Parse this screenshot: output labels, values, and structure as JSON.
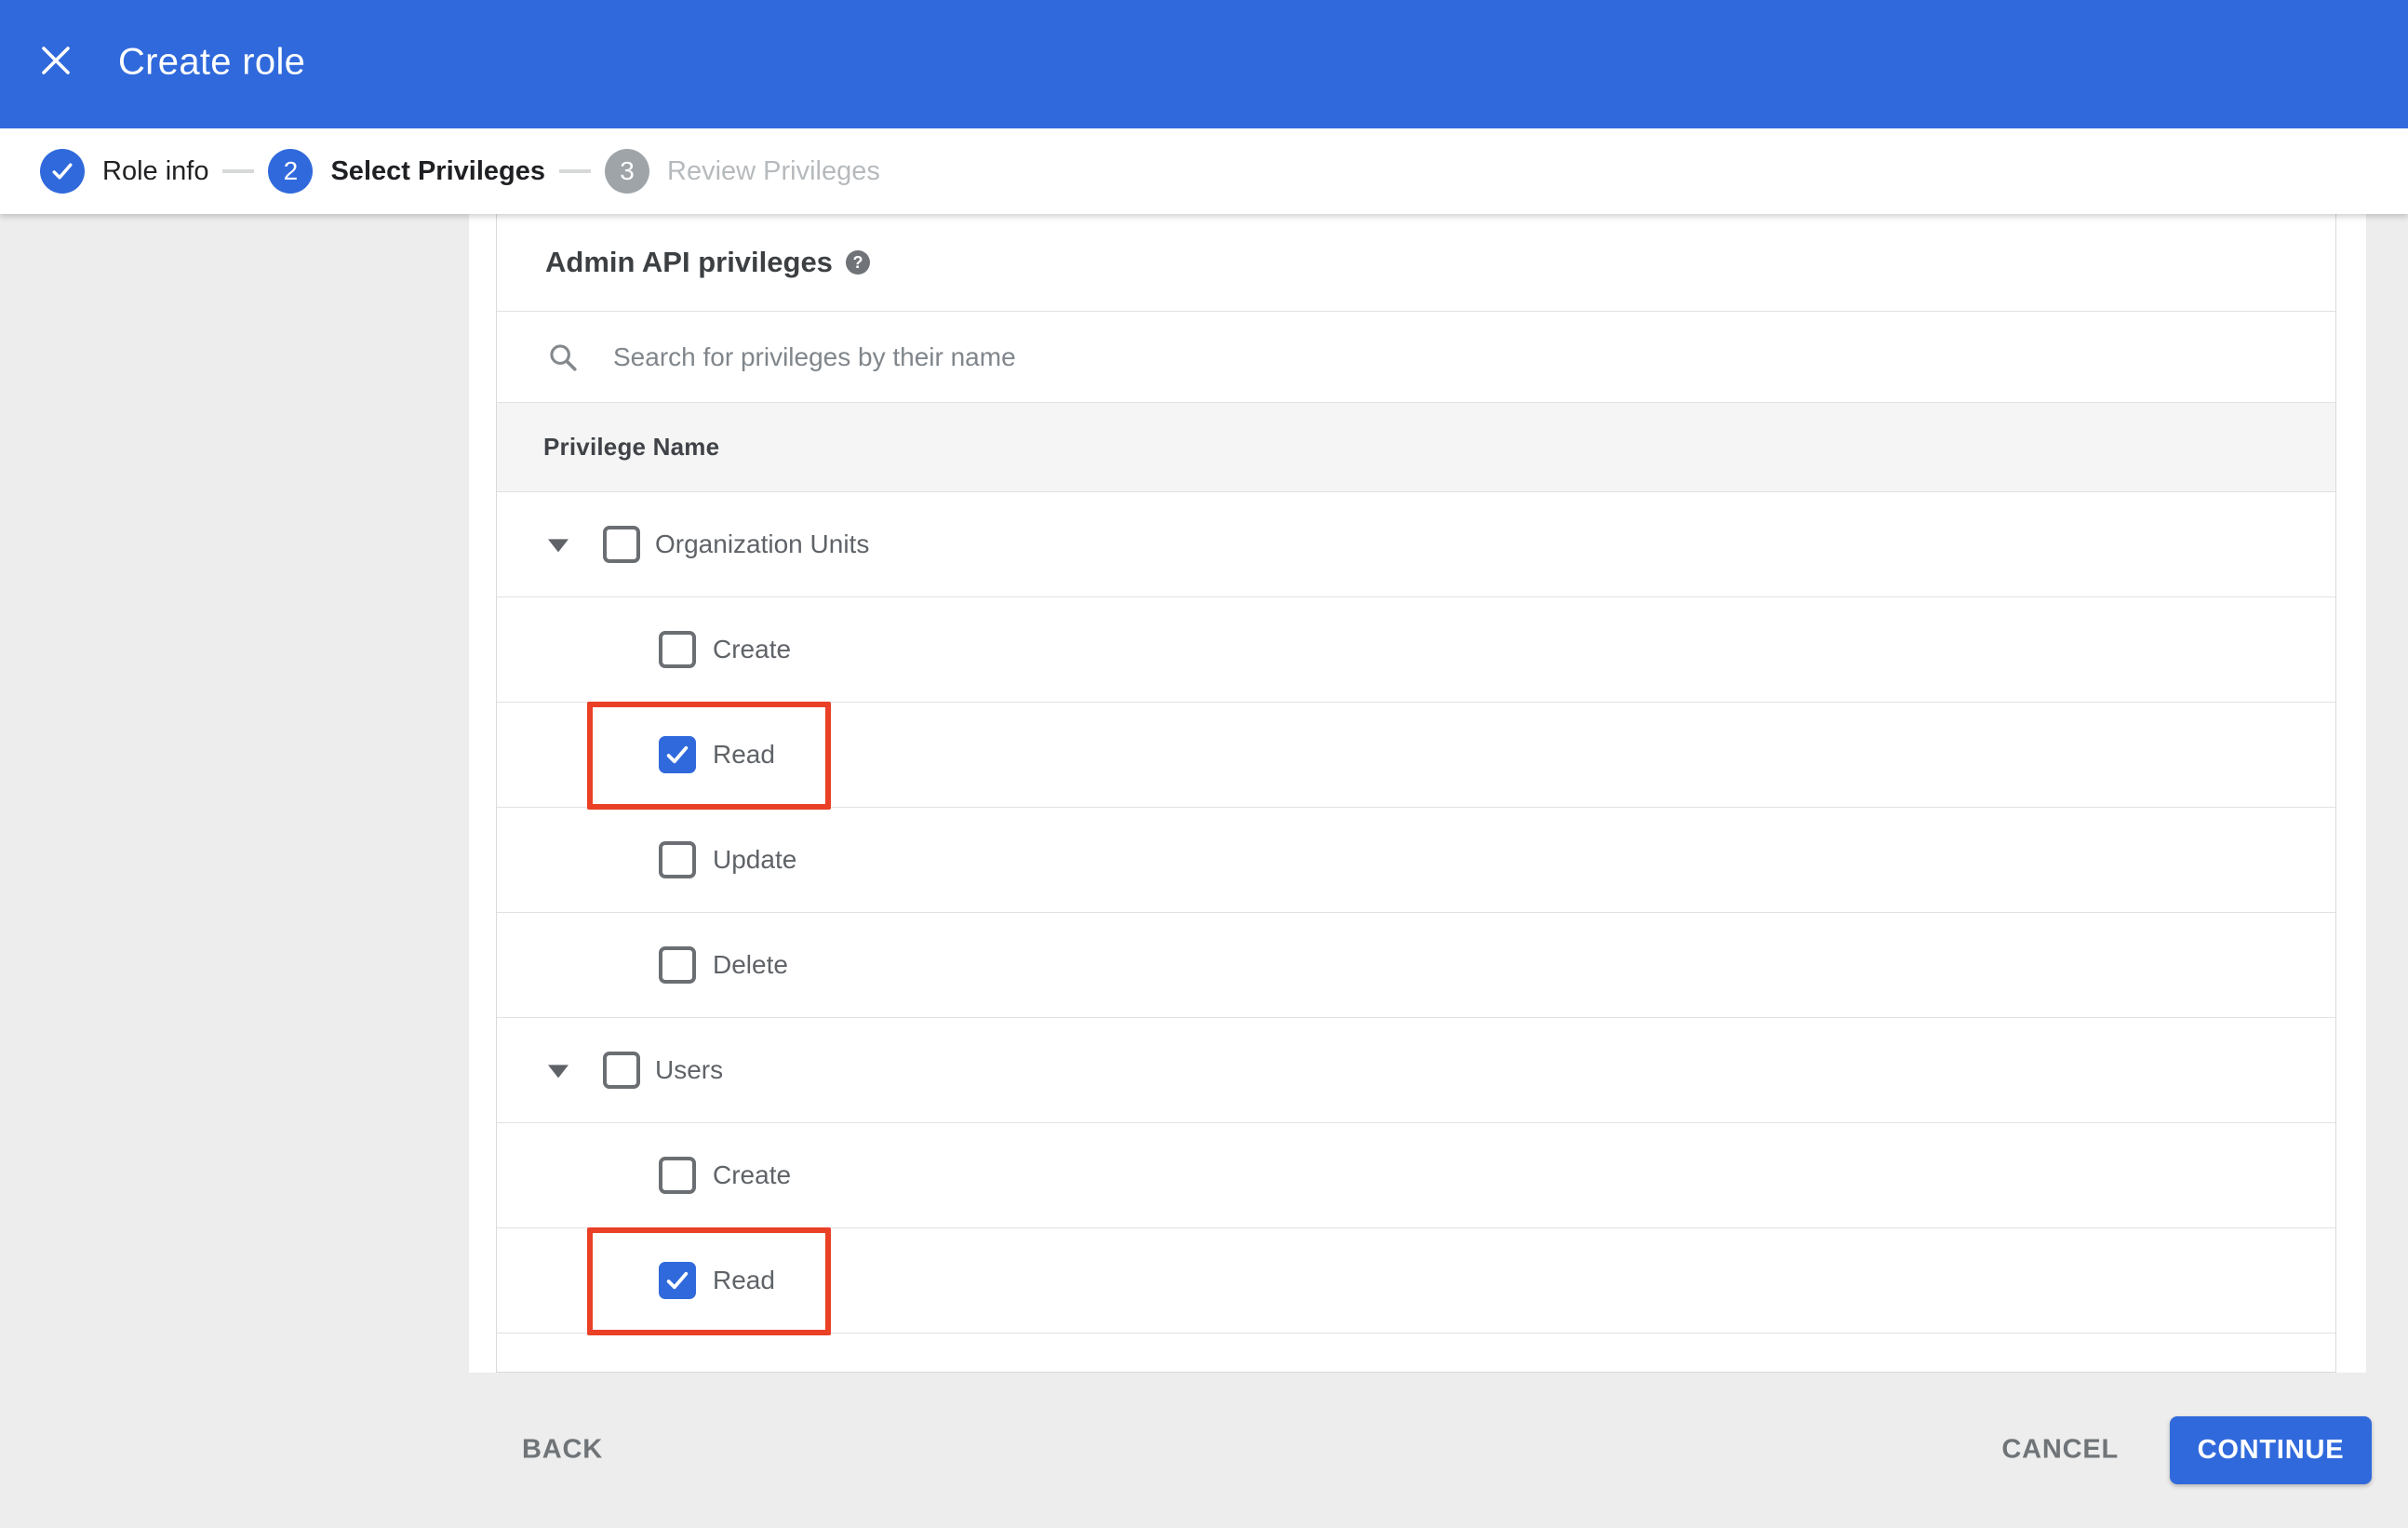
{
  "window": {
    "title": "Create role"
  },
  "stepper": {
    "steps": [
      {
        "number": "",
        "label": "Role info",
        "state": "complete"
      },
      {
        "number": "2",
        "label": "Select Privileges",
        "state": "active"
      },
      {
        "number": "3",
        "label": "Review Privileges",
        "state": "upcoming"
      }
    ]
  },
  "content": {
    "section_title": "Admin API privileges",
    "search_placeholder": "Search for privileges by their name",
    "column_header": "Privilege Name",
    "privileges": [
      {
        "label": "Organization Units",
        "level": 0,
        "expanded": true,
        "checked": false,
        "highlighted": false
      },
      {
        "label": "Create",
        "level": 1,
        "checked": false,
        "highlighted": false
      },
      {
        "label": "Read",
        "level": 1,
        "checked": true,
        "highlighted": true
      },
      {
        "label": "Update",
        "level": 1,
        "checked": false,
        "highlighted": false
      },
      {
        "label": "Delete",
        "level": 1,
        "checked": false,
        "highlighted": false
      },
      {
        "label": "Users",
        "level": 0,
        "expanded": true,
        "checked": false,
        "highlighted": false
      },
      {
        "label": "Create",
        "level": 1,
        "checked": false,
        "highlighted": false
      },
      {
        "label": "Read",
        "level": 1,
        "checked": true,
        "highlighted": true
      }
    ]
  },
  "footer": {
    "back": "BACK",
    "cancel": "CANCEL",
    "continue": "CONTINUE"
  },
  "colors": {
    "accent_blue": "#3069dc",
    "highlight_red": "#e94026",
    "inactive_step_gray": "#9fa4a9",
    "panel_gray": "#ededed"
  }
}
